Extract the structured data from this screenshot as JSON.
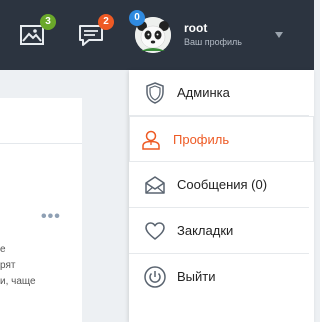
{
  "header": {
    "images_badge": "3",
    "messages_badge": "2",
    "avatar_badge": "0",
    "user_name": "root",
    "user_subtitle": "Ваш профиль"
  },
  "background_text": {
    "line1": "е",
    "line2": "рят",
    "line3": "и, чаще"
  },
  "menu": {
    "items": [
      {
        "label": "Админка",
        "icon": "shield-icon"
      },
      {
        "label": "Профиль",
        "icon": "user-icon",
        "active": true
      },
      {
        "label": "Сообщения (0)",
        "icon": "envelope-icon"
      },
      {
        "label": "Закладки",
        "icon": "heart-icon"
      },
      {
        "label": "Выйти",
        "icon": "power-icon"
      }
    ]
  },
  "colors": {
    "topbar": "#2c3440",
    "accent": "#ee5a24",
    "badge_green": "#6aa82a",
    "badge_orange": "#ee5a24",
    "badge_blue": "#2f8ae0"
  }
}
